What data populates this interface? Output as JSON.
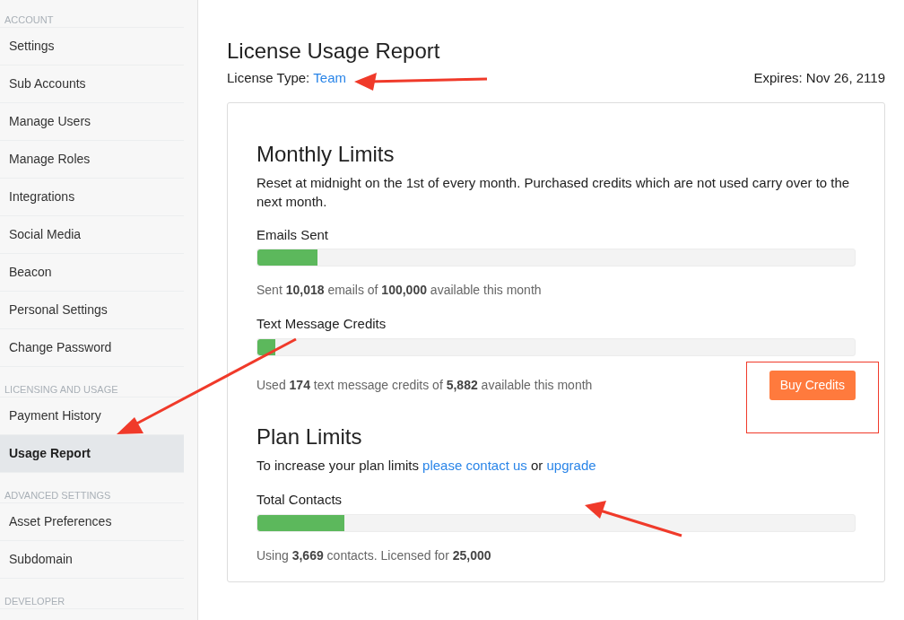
{
  "sidebar": {
    "sections": [
      {
        "heading": "ACCOUNT",
        "items": [
          {
            "label": "Settings",
            "selected": false
          },
          {
            "label": "Sub Accounts",
            "selected": false
          },
          {
            "label": "Manage Users",
            "selected": false
          },
          {
            "label": "Manage Roles",
            "selected": false
          },
          {
            "label": "Integrations",
            "selected": false
          },
          {
            "label": "Social Media",
            "selected": false
          },
          {
            "label": "Beacon",
            "selected": false
          },
          {
            "label": "Personal Settings",
            "selected": false
          },
          {
            "label": "Change Password",
            "selected": false
          }
        ]
      },
      {
        "heading": "LICENSING AND USAGE",
        "items": [
          {
            "label": "Payment History",
            "selected": false
          },
          {
            "label": "Usage Report",
            "selected": true
          }
        ]
      },
      {
        "heading": "ADVANCED SETTINGS",
        "items": [
          {
            "label": "Asset Preferences",
            "selected": false
          },
          {
            "label": "Subdomain",
            "selected": false
          }
        ]
      },
      {
        "heading": "DEVELOPER"
      }
    ]
  },
  "page": {
    "title": "License Usage Report",
    "license_label": "License Type:",
    "license_type": "Team",
    "expires": "Expires: Nov 26, 2119"
  },
  "monthly": {
    "title": "Monthly Limits",
    "description": "Reset at midnight on the 1st of every month. Purchased credits which are not used carry over to the next month.",
    "meters": [
      {
        "label": "Emails Sent",
        "level": 0.1,
        "caption": "Sent **10,018** emails of **100,000** available this month"
      },
      {
        "label": "Text Message Credits",
        "level": 0.03,
        "caption": "Used **174** text message credits of **5,882** available this month",
        "button": "Buy Credits"
      }
    ]
  },
  "plan": {
    "title": "Plan Limits",
    "description": [
      {
        "kind": "text",
        "text": "To increase your plan limits"
      },
      {
        "kind": "link",
        "text": "please contact us"
      },
      {
        "kind": "text",
        "text": "or"
      },
      {
        "kind": "link",
        "text": "upgrade"
      }
    ],
    "meters": [
      {
        "label": "Total Contacts",
        "level": 0.146,
        "caption": "Using **3,669** contacts. Licensed for **25,000**"
      }
    ]
  }
}
